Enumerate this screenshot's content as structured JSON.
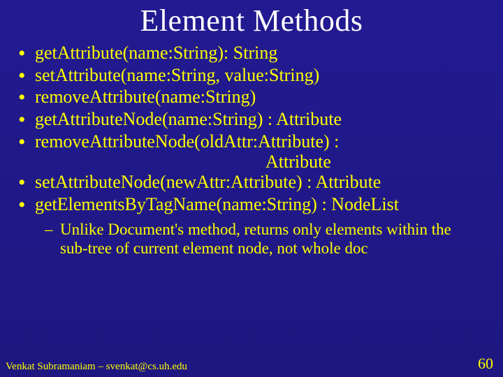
{
  "title": "Element Methods",
  "bullets": [
    "getAttribute(name:String): String",
    "setAttribute(name:String, value:String)",
    "removeAttribute(name:String)",
    "getAttributeNode(name:String) : Attribute",
    "removeAttributeNode(oldAttr:Attribute) :",
    "setAttributeNode(newAttr:Attribute) : Attribute",
    "getElementsByTagName(name:String) : NodeList"
  ],
  "continuation_after_4": "Attribute",
  "sub": [
    "Unlike Document's method, returns only elements within the sub-tree of current element node, not whole doc"
  ],
  "footer_left": "Venkat Subramaniam – svenkat@cs.uh.edu",
  "footer_right": "60"
}
